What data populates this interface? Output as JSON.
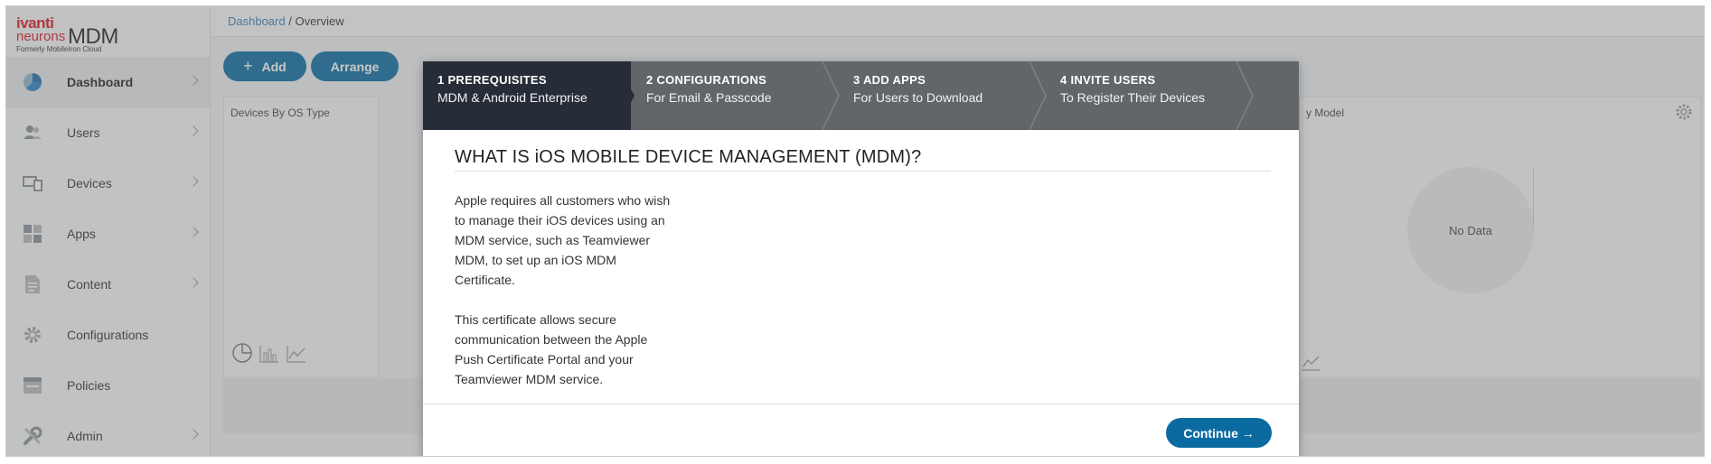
{
  "logo": {
    "brand_top": "ivanti",
    "brand_bottom": "neurons",
    "product": "MDM",
    "formerly": "Formerly MobileIron Cloud"
  },
  "sidebar": {
    "items": [
      {
        "label": "Dashboard",
        "icon": "pie-chart-icon",
        "active": true
      },
      {
        "label": "Users",
        "icon": "users-icon"
      },
      {
        "label": "Devices",
        "icon": "devices-icon"
      },
      {
        "label": "Apps",
        "icon": "apps-grid-icon"
      },
      {
        "label": "Content",
        "icon": "document-icon"
      },
      {
        "label": "Configurations",
        "icon": "gear-icon"
      },
      {
        "label": "Policies",
        "icon": "policies-icon"
      },
      {
        "label": "Admin",
        "icon": "wrench-icon"
      }
    ]
  },
  "breadcrumb": {
    "link": "Dashboard",
    "separator": " / ",
    "current": "Overview"
  },
  "toolbar": {
    "add_label": "Add",
    "arrange_label": "Arrange"
  },
  "panels": {
    "left_title": "Devices By OS Type",
    "right_title": "y Model",
    "no_data": "No Data"
  },
  "wizard": {
    "steps": [
      {
        "title": "1 PREREQUISITES",
        "subtitle": "MDM & Android Enterprise"
      },
      {
        "title": "2 CONFIGURATIONS",
        "subtitle": "For Email & Passcode"
      },
      {
        "title": "3 ADD APPS",
        "subtitle": "For Users to Download"
      },
      {
        "title": "4 INVITE USERS",
        "subtitle": "To Register Their Devices"
      }
    ],
    "heading": "WHAT IS iOS MOBILE DEVICE MANAGEMENT (MDM)?",
    "paragraphs": [
      "Apple requires all customers who wish to manage their iOS devices using an MDM service, such as Teamviewer MDM, to set up an iOS MDM Certificate.",
      "This certificate allows secure communication between the Apple Push Certificate Portal and your Teamviewer MDM service."
    ],
    "continue_label": "Continue →"
  },
  "colors": {
    "accent": "#0b6ba1",
    "brand_red": "#d71920",
    "step_active": "#262d38",
    "step_inactive": "#62666b"
  }
}
